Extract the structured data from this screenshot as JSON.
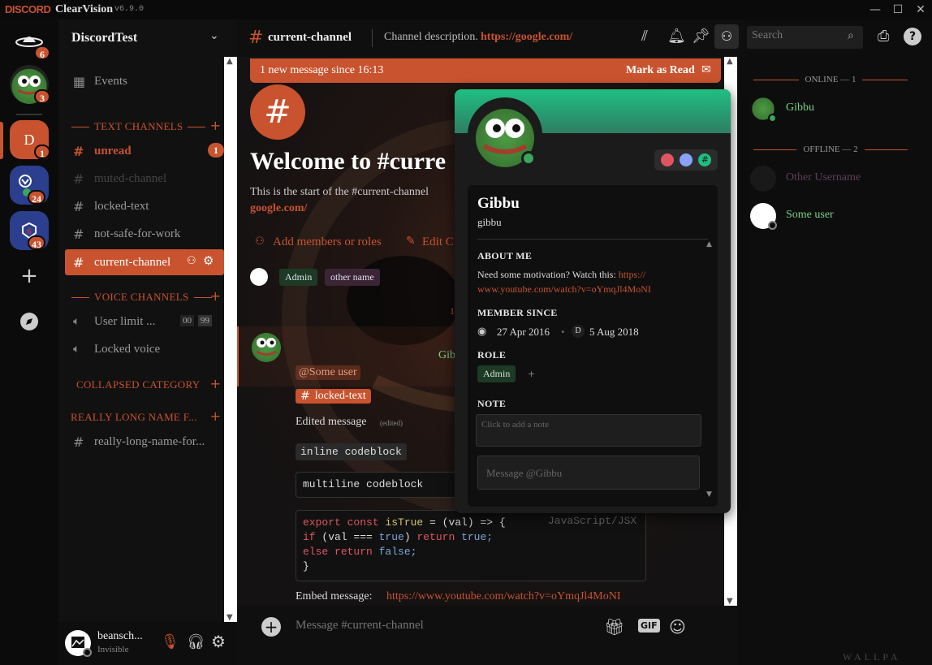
{
  "titlebar": {
    "logo": "DISCORD",
    "app": "ClearVision",
    "version": "v6.9.0",
    "minimize": "—",
    "maximize": "☐",
    "close": "✕"
  },
  "servers": {
    "home_badge": "6",
    "pepe_badge": "3",
    "d_letter": "D",
    "d_badge": "1",
    "ow_badge": "24",
    "r6_badge": "43",
    "add": "+",
    "explore": "⊘"
  },
  "guild": {
    "name": "DiscordTest",
    "events": "Events"
  },
  "categories": {
    "text": "TEXT CHANNELS",
    "voice": "VOICE CHANNELS",
    "collapsed": "COLLAPSED CATEGORY",
    "long": "REALLY LONG NAME F..."
  },
  "channels": {
    "unread": "unread",
    "unread_badge": "1",
    "muted": "muted-channel",
    "locked": "locked-text",
    "nsfw": "not-safe-for-work",
    "current": "current-channel",
    "voice_limit": "User limit ...",
    "voice_users": "00",
    "voice_max": "99",
    "locked_voice": "Locked voice",
    "long_channel": "really-long-name-for..."
  },
  "topbar": {
    "channel": "current-channel",
    "description": "Channel description.",
    "link": "https://google.com/",
    "search_placeholder": "Search"
  },
  "banner": {
    "text": "1 new message since 16:13",
    "action": "Mark as Read"
  },
  "welcome": {
    "title": "Welcome to #curre",
    "subtitle": "This is the start of the #current-channel",
    "link": "google.com/",
    "add_members": "Add members or roles",
    "edit": "Edit C"
  },
  "roles_row": {
    "admin": "Admin",
    "other": "other name"
  },
  "divider_num": "1",
  "message": {
    "author_partial": "Gib",
    "mention": "@Some user",
    "channel_mention": "locked-text",
    "edited": "Edited message",
    "edited_tag": "(edited)",
    "inline_code": "inline codeblock",
    "multiline": "multiline codeblock",
    "code_lang": "JavaScript/JSX",
    "code_l1a": "export const ",
    "code_l1b": "isTrue",
    "code_l1c": " = (val) => {",
    "code_l2a": "if",
    "code_l2b": " (val === ",
    "code_l2c": "true",
    "code_l2d": ") ",
    "code_l2e": "return",
    "code_l2f": " true;",
    "code_l3a": "else",
    "code_l3b": " return",
    "code_l3c": " false;",
    "code_l4": "}",
    "embed_label": "Embed message:",
    "embed_link": "https://www.youtube.com/watch?v=oYmqJl4MoNI"
  },
  "composer": {
    "placeholder": "Message #current-channel",
    "gif": "GIF"
  },
  "user": {
    "name": "beansch...",
    "status": "Invisible"
  },
  "popout": {
    "display": "Gibbu",
    "username": "gibbu",
    "about_h": "ABOUT ME",
    "about_text": "Need some motivation? Watch this:",
    "about_link1": "https://",
    "about_link2": "www.youtube.com/watch?v=oYmqJl4MoNI",
    "since_h": "MEMBER SINCE",
    "since_discord": "27 Apr 2016",
    "since_guild": "5 Aug 2018",
    "guild_letter": "D",
    "role_h": "ROLE",
    "role": "Admin",
    "role_add": "+",
    "note_h": "NOTE",
    "note_placeholder": "Click to add a note",
    "msg_placeholder": "Message @Gibbu"
  },
  "members": {
    "online_h": "ONLINE — 1",
    "offline_h": "OFFLINE — 2",
    "m1": "Gibbu",
    "m2": "Other Username",
    "m3": "Some user"
  },
  "watermark": "WALLPA",
  "colors": {
    "accent": "#c8532e",
    "online": "#3ba55c",
    "role_admin": "#7ad18a"
  }
}
